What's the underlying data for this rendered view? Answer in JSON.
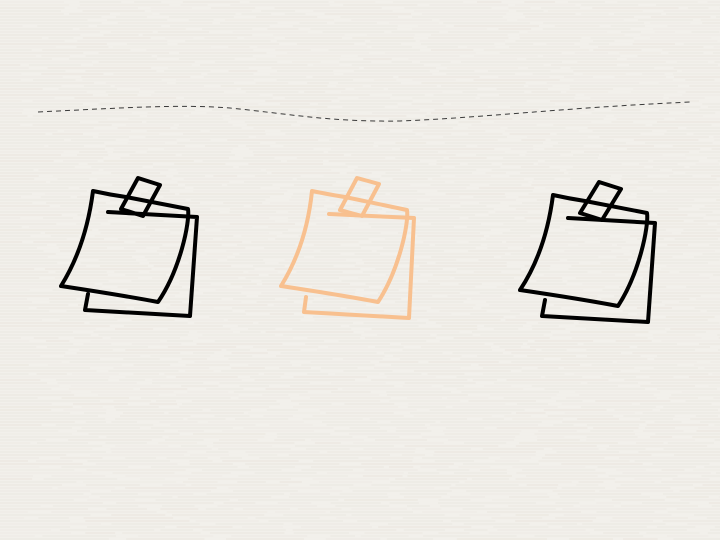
{
  "background": {
    "color": "#f2f0eb",
    "texture_line_color": "#e6e2da"
  },
  "divider": {
    "color": "#3a3a3a",
    "style": "dashed"
  },
  "notes": [
    {
      "name": "sticky-note-left",
      "stroke_color": "#000000"
    },
    {
      "name": "sticky-note-center",
      "stroke_color": "#f8c08f"
    },
    {
      "name": "sticky-note-right",
      "stroke_color": "#000000"
    }
  ]
}
